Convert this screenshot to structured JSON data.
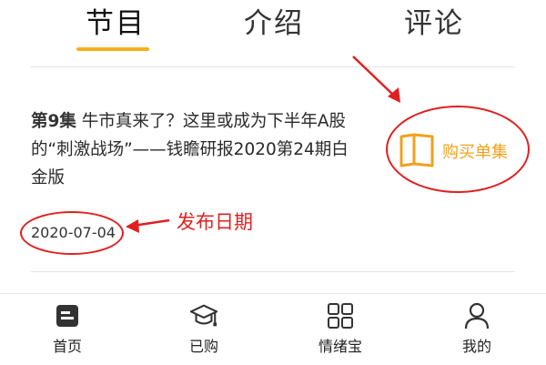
{
  "tabs": [
    {
      "label": "节目",
      "active": true
    },
    {
      "label": "介绍",
      "active": false
    },
    {
      "label": "评论",
      "active": false
    }
  ],
  "accent_color": "#f5b01c",
  "annotation_color": "#e02020",
  "episode": {
    "number_label": "第9集",
    "title": "牛市真来了？这里或成为下半年A股的“刺激战场”——钱瞻研报2020第24期白金版",
    "date": "2020-07-04"
  },
  "buy_button": {
    "label": "购买单集",
    "icon": "book-icon"
  },
  "annotations": {
    "date_note": "发布日期"
  },
  "bottom_nav": [
    {
      "label": "首页",
      "icon": "home-icon"
    },
    {
      "label": "已购",
      "icon": "graduation-cap-icon"
    },
    {
      "label": "情绪宝",
      "icon": "grid-icon"
    },
    {
      "label": "我的",
      "icon": "user-icon"
    }
  ]
}
